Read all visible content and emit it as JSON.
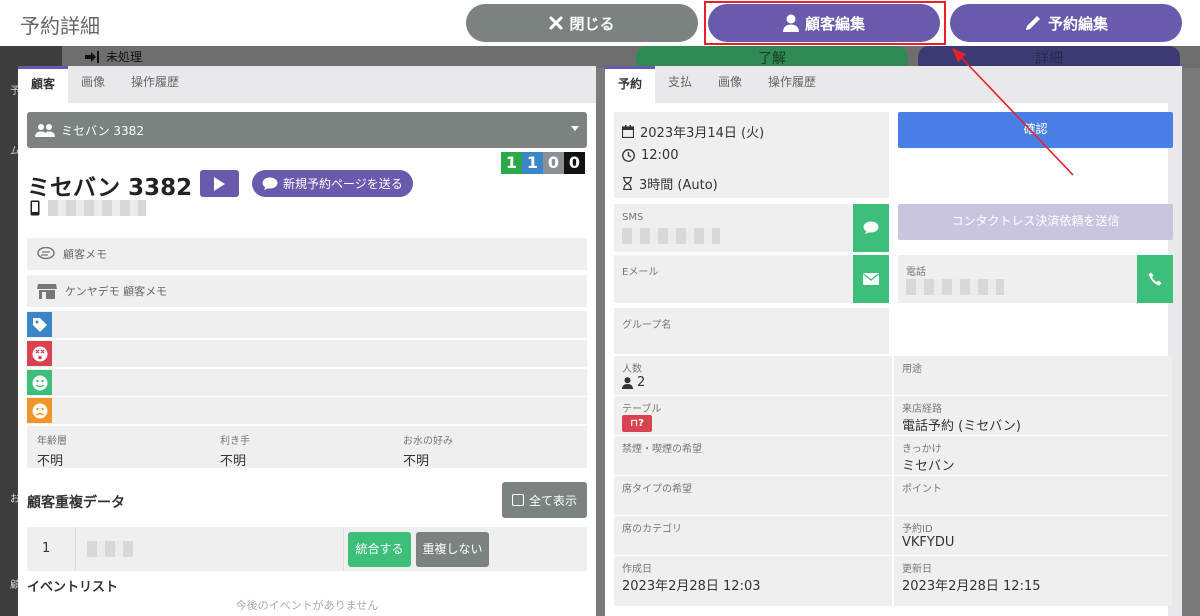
{
  "header": {
    "title": "予約詳細",
    "close_label": "閉じる",
    "edit_customer_label": "顧客編集",
    "edit_booking_label": "予約編集"
  },
  "background": {
    "status_label": "未処理",
    "ok_label": "了解",
    "detail_label": "詳細",
    "sidebar_labels": [
      "予",
      "ム",
      "お",
      "顧"
    ]
  },
  "left_panel": {
    "tabs": [
      {
        "label": "顧客",
        "active": true
      },
      {
        "label": "画像",
        "active": false
      },
      {
        "label": "操作履歴",
        "active": false
      }
    ],
    "customer_select": "ミセバン 3382",
    "counts": [
      {
        "value": "1",
        "color": "#2aa84a"
      },
      {
        "value": "1",
        "color": "#3a86c8"
      },
      {
        "value": "0",
        "color": "#8a9196"
      },
      {
        "value": "0",
        "color": "#111111"
      }
    ],
    "customer_name": "ミセバン 3382",
    "send_page_label": "新規予約ページを送る",
    "memo_label": "顧客メモ",
    "shop_memo_label": "ケンヤデモ 顧客メモ",
    "attributes": [
      {
        "label": "年齢層",
        "value": "不明"
      },
      {
        "label": "利き手",
        "value": "不明"
      },
      {
        "label": "お水の好み",
        "value": "不明"
      }
    ],
    "duplicate_title": "顧客重複データ",
    "show_all_label": "全て表示",
    "duplicate_row": {
      "index": "1",
      "merge_label": "統合する",
      "not_dup_label": "重複しない"
    },
    "event_list_title": "イベントリスト",
    "no_events_text": "今後のイベントがありません"
  },
  "right_panel": {
    "tabs": [
      {
        "label": "予約",
        "active": true
      },
      {
        "label": "支払",
        "active": false
      },
      {
        "label": "画像",
        "active": false
      },
      {
        "label": "操作履歴",
        "active": false
      }
    ],
    "date": "2023年3月14日 (火)",
    "time": "12:00",
    "duration": "3時間 (Auto)",
    "confirm_label": "確認",
    "sms_label": "SMS",
    "contactless_label": "コンタクトレス決済依頼を送信",
    "email_label": "Eメール",
    "phone_label": "電話",
    "group_label": "グループ名",
    "grid": {
      "party_label": "人数",
      "party_value": "2",
      "purpose_label": "用途",
      "table_label": "テーブル",
      "visit_route_label": "来店経路",
      "visit_route_value": "電話予約 (ミセバン)",
      "smoking_label": "禁煙・喫煙の希望",
      "trigger_label": "きっかけ",
      "trigger_value": "ミセバン",
      "seat_type_label": "席タイプの希望",
      "points_label": "ポイント",
      "seat_category_label": "席のカテゴリ",
      "booking_id_label": "予約ID",
      "booking_id_value": "VKFYDU",
      "created_label": "作成日",
      "created_value": "2023年2月28日 12:03",
      "updated_label": "更新日",
      "updated_value": "2023年2月28日 12:15"
    }
  },
  "colors": {
    "accent": "#6a5aae",
    "green": "#3dbf7a",
    "gray_button": "#7b8280",
    "confirm_blue": "#4a7fe6",
    "highlight_red": "#e8202a"
  }
}
